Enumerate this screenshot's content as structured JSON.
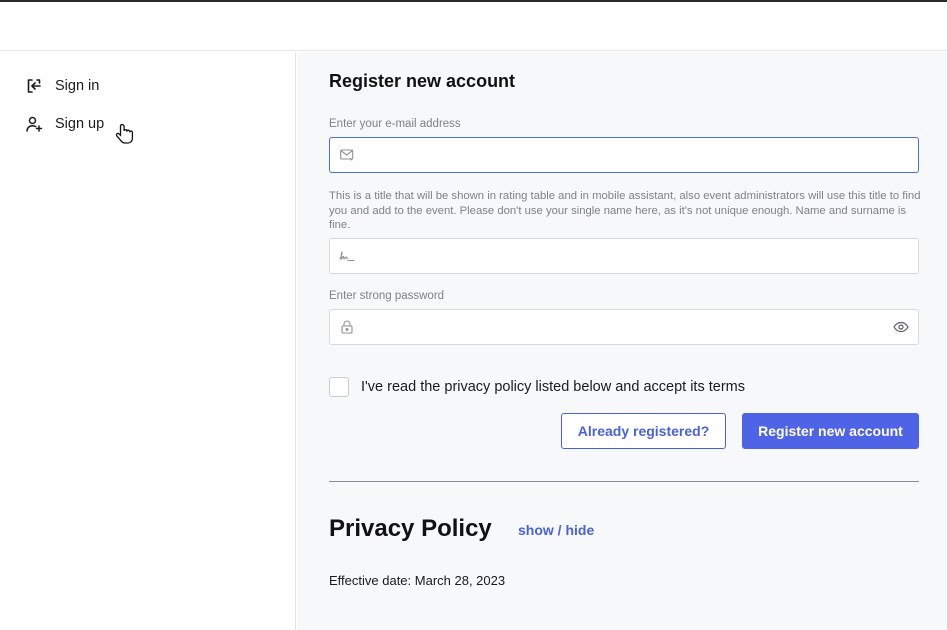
{
  "sidebar": {
    "items": [
      {
        "label": "Sign in",
        "icon": "sign-in-icon"
      },
      {
        "label": "Sign up",
        "icon": "user-plus-icon"
      }
    ]
  },
  "form": {
    "title": "Register new account",
    "email": {
      "label": "Enter your e-mail address",
      "value": "",
      "placeholder": "",
      "icon": "mail-icon"
    },
    "name": {
      "hint": "This is a title that will be shown in rating table and in mobile assistant, also event administrators will use this title to find you and add to the event. Please don't use your single name here, as it's not unique enough. Name and surname is fine.",
      "value": "",
      "placeholder": "",
      "icon": "signature-icon"
    },
    "password": {
      "label": "Enter strong password",
      "value": "",
      "placeholder": "",
      "icon": "lock-icon",
      "toggle_icon": "eye-icon"
    },
    "terms": {
      "label": "I've read the privacy policy listed below and accept its terms",
      "checked": false
    },
    "already_registered_label": "Already registered?",
    "submit_label": "Register new account"
  },
  "privacy": {
    "title": "Privacy Policy",
    "toggle_label": "show / hide",
    "effective_date": "Effective date: March 28, 2023"
  },
  "colors": {
    "accent": "#4f63e6",
    "link": "#4a62d8",
    "muted_text": "#7d8189",
    "main_bg": "#f7f8fa"
  }
}
